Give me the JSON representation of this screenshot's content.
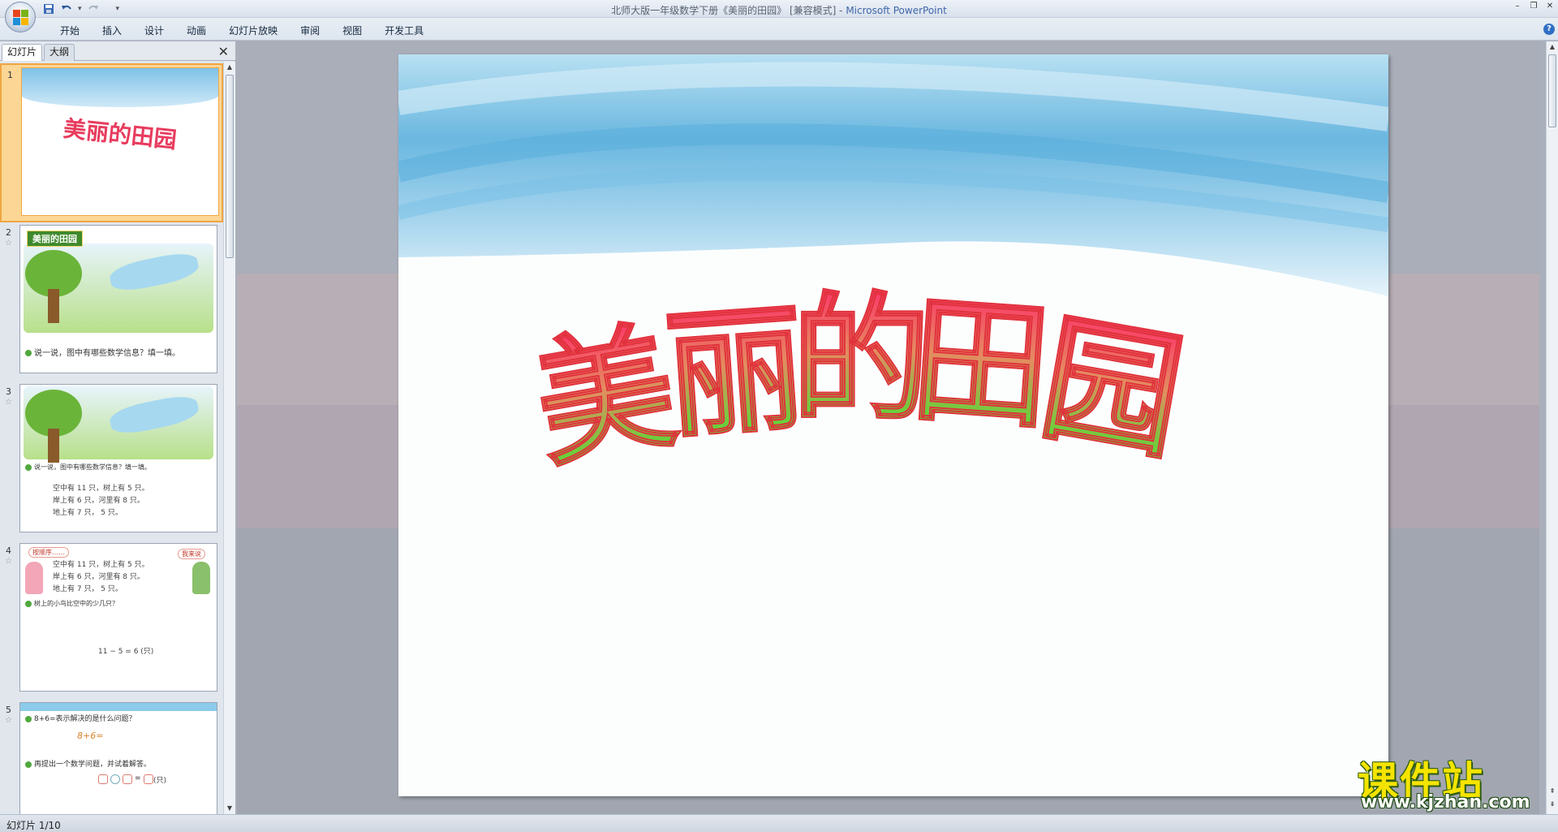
{
  "window": {
    "title_doc": "北师大版一年级数学下册《美丽的田园》 [兼容模式] -",
    "title_app": "Microsoft PowerPoint"
  },
  "quick_access": {
    "save_icon": "save-icon",
    "undo_icon": "undo-icon",
    "redo_icon": "redo-icon",
    "customize_icon": "dropdown-icon"
  },
  "ribbon": {
    "tabs": [
      "开始",
      "插入",
      "设计",
      "动画",
      "幻灯片放映",
      "审阅",
      "视图",
      "开发工具"
    ]
  },
  "left_pane": {
    "tabs": [
      "幻灯片",
      "大纲"
    ],
    "slides": [
      {
        "number": "1",
        "title": "美丽的田园"
      },
      {
        "number": "2",
        "banner": "美丽的田园",
        "question": "说一说，图中有哪些数学信息？填一填。"
      },
      {
        "number": "3",
        "question": "说一说，图中有哪些数学信息？填一填。",
        "lines": [
          "空中有 11 只，树上有 5 只。",
          "岸上有 6 只，河里有 8 只。",
          "地上有 7 只，  5 只。"
        ]
      },
      {
        "number": "4",
        "bubble_left": "按顺序……",
        "bubble_right": "我来说",
        "lines": [
          "空中有 11 只，树上有 5 只。",
          "岸上有 6 只，河里有 8 只。",
          "地上有 7 只，  5 只。"
        ],
        "question": "树上的小鸟比空中的少几只？",
        "equation": "11 − 5 = 6 (只)"
      },
      {
        "number": "5",
        "question": "8+6=表示解决的是什么问题？",
        "formula": "8+6=",
        "question2": "再提出一个数学问题，并试着解答。",
        "equation": "(只)"
      }
    ]
  },
  "slide": {
    "title": "美丽的田园",
    "colors": {
      "top": "#ff2a6b",
      "bottom": "#2ef02a",
      "sky": "#6ab7e0"
    }
  },
  "status": {
    "text": "幻灯片 1/10"
  },
  "watermark": {
    "main": "课件站",
    "url": "www.kjzhan.com"
  }
}
